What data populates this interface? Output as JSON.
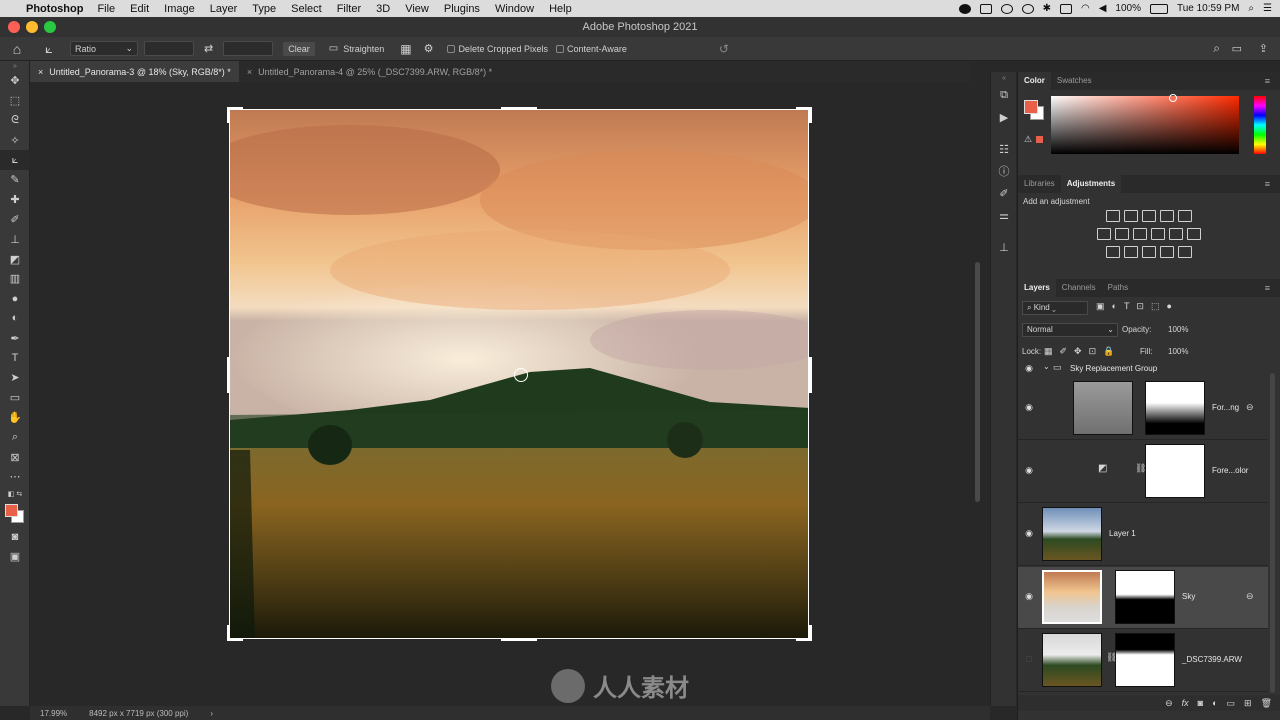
{
  "menubar": {
    "app": "Photoshop",
    "items": [
      "File",
      "Edit",
      "Image",
      "Layer",
      "Type",
      "Select",
      "Filter",
      "3D",
      "View",
      "Plugins",
      "Window",
      "Help"
    ],
    "battery": "100%",
    "clock": "Tue 10:59 PM"
  },
  "window": {
    "title": "Adobe Photoshop 2021"
  },
  "options": {
    "ratio": "Ratio",
    "clear": "Clear",
    "straighten": "Straighten",
    "delete_cropped": "Delete Cropped Pixels",
    "content_aware": "Content-Aware"
  },
  "tabs": [
    {
      "label": "Untitled_Panorama-3 @ 18% (Sky, RGB/8*) *"
    },
    {
      "label": "Untitled_Panorama-4 @ 25% (_DSC7399.ARW, RGB/8*) *"
    }
  ],
  "status": {
    "zoom": "17.99%",
    "doc_info": "8492 px x 7719 px (300 ppi)"
  },
  "color_panel": {
    "tabs": [
      "Color",
      "Swatches"
    ],
    "fg_color": "#e8604a",
    "bg_color": "#ffffff"
  },
  "adjustments_panel": {
    "tabs": [
      "Libraries",
      "Adjustments"
    ],
    "hint": "Add an adjustment"
  },
  "layers_panel": {
    "tabs": [
      "Layers",
      "Channels",
      "Paths"
    ],
    "filter_kind": "Kind",
    "blend_mode": "Normal",
    "opacity_label": "Opacity:",
    "opacity_value": "100%",
    "lock_label": "Lock:",
    "fill_label": "Fill:",
    "fill_value": "100%",
    "group_name": "Sky Replacement Group",
    "layers": [
      {
        "name": "For...ng"
      },
      {
        "name": "Fore...olor"
      },
      {
        "name": "Layer 1"
      },
      {
        "name": "Sky"
      },
      {
        "name": "_DSC7399.ARW"
      }
    ]
  },
  "watermark": {
    "text": "人人素材"
  }
}
